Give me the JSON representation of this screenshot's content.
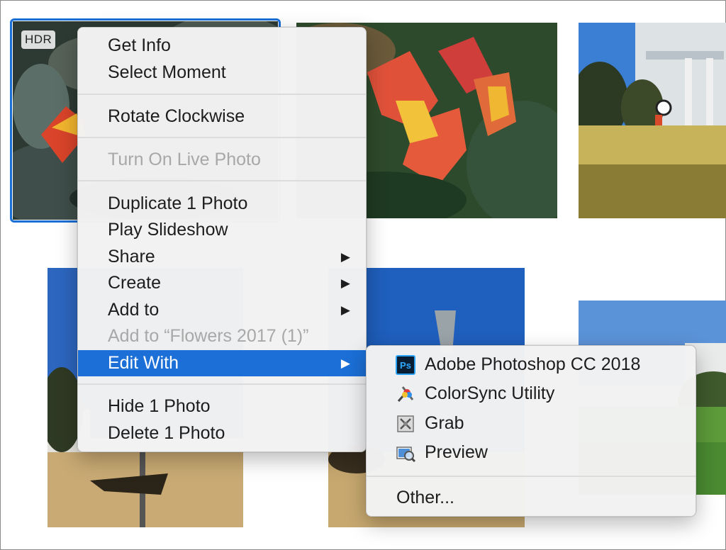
{
  "photos": {
    "hdr_badge": "HDR"
  },
  "context_menu": {
    "items": [
      {
        "label": "Get Info",
        "enabled": true
      },
      {
        "label": "Select Moment",
        "enabled": true
      },
      {
        "label": "Rotate Clockwise",
        "enabled": true
      },
      {
        "label": "Turn On Live Photo",
        "enabled": false
      },
      {
        "label": "Duplicate 1 Photo",
        "enabled": true
      },
      {
        "label": "Play Slideshow",
        "enabled": true
      },
      {
        "label": "Share",
        "enabled": true,
        "submenu": true
      },
      {
        "label": "Create",
        "enabled": true,
        "submenu": true
      },
      {
        "label": "Add to",
        "enabled": true,
        "submenu": true
      },
      {
        "label": "Add to “Flowers 2017 (1)”",
        "enabled": false
      },
      {
        "label": "Edit With",
        "enabled": true,
        "submenu": true,
        "highlighted": true
      },
      {
        "label": "Hide 1 Photo",
        "enabled": true
      },
      {
        "label": "Delete 1 Photo",
        "enabled": true
      }
    ],
    "submenu_arrow": "▶"
  },
  "edit_with_submenu": {
    "items": [
      {
        "label": "Adobe Photoshop CC 2018",
        "icon": "photoshop-icon",
        "icon_text": "Ps"
      },
      {
        "label": "ColorSync Utility",
        "icon": "colorsync-utility-icon"
      },
      {
        "label": "Grab",
        "icon": "grab-icon"
      },
      {
        "label": "Preview",
        "icon": "preview-icon"
      },
      {
        "label": "Other...",
        "icon": null
      }
    ]
  },
  "colors": {
    "selection": "#1a6fd6",
    "highlight": "#1b6fd6",
    "menu_bg": "#f2f2f2",
    "disabled_text": "#a8a8a8"
  }
}
